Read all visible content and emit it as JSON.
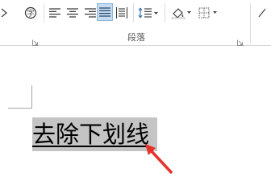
{
  "ribbon": {
    "paragraph_group_label": "段落",
    "buttons": [
      {
        "name": "clear-format-button",
        "icon": "clear-format-icon"
      },
      {
        "name": "align-left-button",
        "icon": "align-left-icon"
      },
      {
        "name": "align-center-button",
        "icon": "align-center-icon"
      },
      {
        "name": "align-right-button",
        "icon": "align-right-icon"
      },
      {
        "name": "justify-button",
        "icon": "justify-icon",
        "active": true
      },
      {
        "name": "distributed-button",
        "icon": "distributed-icon"
      },
      {
        "name": "line-spacing-button",
        "icon": "line-spacing-icon"
      },
      {
        "name": "shading-button",
        "icon": "shading-icon"
      },
      {
        "name": "borders-button",
        "icon": "borders-icon"
      }
    ]
  },
  "document": {
    "selected_text": "去除下划线"
  },
  "colors": {
    "active_button": "#c5dcf0",
    "selection": "#c4c4c4",
    "arrow": "#e8312a"
  }
}
